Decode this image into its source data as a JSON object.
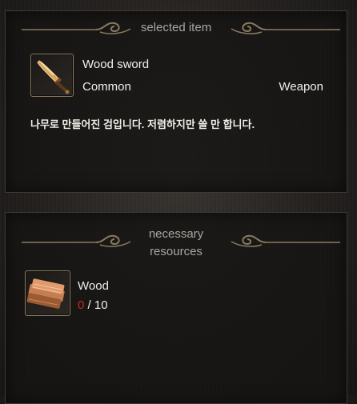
{
  "selected": {
    "header": "selected item",
    "item_name": "Wood sword",
    "rarity": "Common",
    "category": "Weapon",
    "description": "나무로 만들어진 검입니다. 저렴하지만 쓸 만 합니다."
  },
  "resources": {
    "header_line1": "necessary",
    "header_line2": "resources",
    "items": [
      {
        "name": "Wood",
        "have": "0",
        "need": "/ 10"
      }
    ]
  },
  "colors": {
    "shortfall": "#c8281e",
    "ornament": "#8a7b60",
    "icon_border": "#8b7a5e"
  },
  "icons": [
    "wood-sword-icon",
    "wood-plank-icon"
  ]
}
